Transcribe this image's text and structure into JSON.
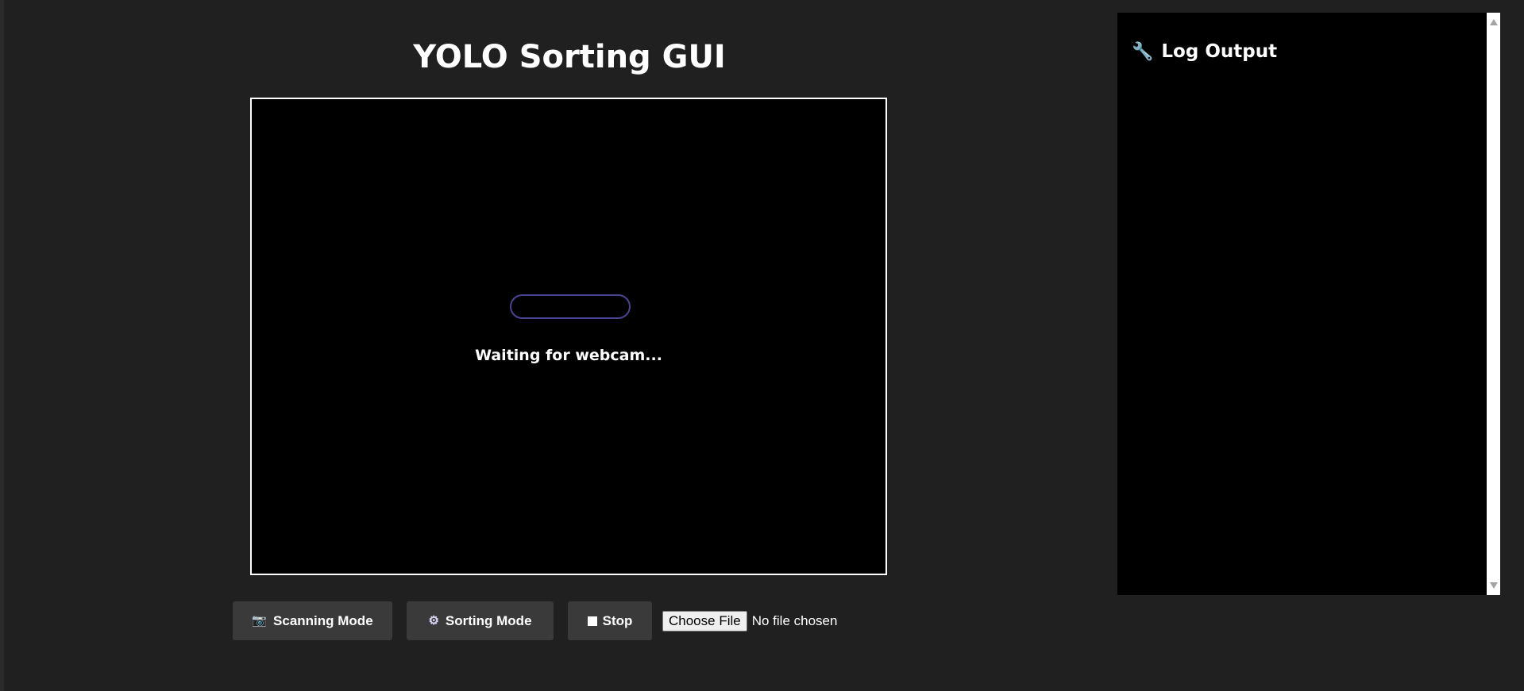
{
  "page": {
    "title": "YOLO Sorting GUI"
  },
  "video": {
    "status_text": "Waiting for webcam..."
  },
  "controls": {
    "scan_icon": "camera-icon",
    "scan_label": "Scanning Mode",
    "sort_icon": "gear-icon",
    "sort_label": "Sorting Mode",
    "stop_icon": "stop-square-icon",
    "stop_label": "Stop",
    "file_button_label": "Choose File",
    "file_status": "No file chosen"
  },
  "log": {
    "icon": "wrench-icon",
    "title": "Log Output",
    "entries": []
  },
  "colors": {
    "background": "#202020",
    "panel": "#000000",
    "button": "#3a3a3a",
    "loader_border": "#4a4490",
    "text": "#ffffff"
  }
}
